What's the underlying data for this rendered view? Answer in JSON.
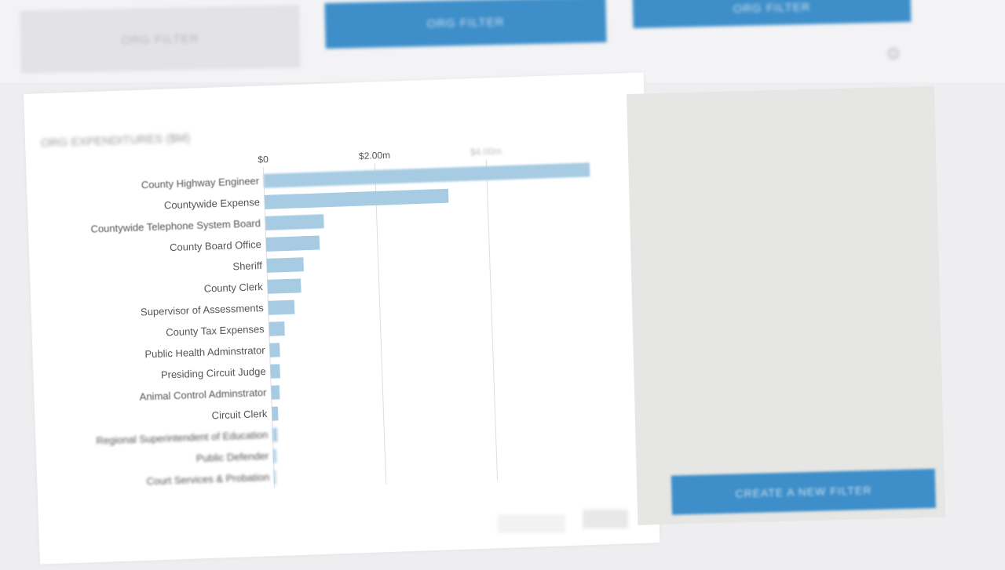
{
  "top_buttons": {
    "grey_label": "ORG FILTER",
    "blue_left_label": "ORG FILTER",
    "blue_right_label": "ORG FILTER"
  },
  "panel": {
    "title": "ORG EXPENDITURES ($M)"
  },
  "side_panel": {
    "text": "",
    "button_label": "CREATE A NEW FILTER"
  },
  "footer": {
    "left": "",
    "right_1": "",
    "right_2": ""
  },
  "colors": {
    "bar": "#a6cbe3",
    "accent": "#3d8ec9",
    "grid": "#dddddd",
    "label": "#555555"
  },
  "chart_data": {
    "type": "bar",
    "orientation": "horizontal",
    "categories": [
      "County Highway Engineer",
      "Countywide Expense",
      "Countywide Telephone System Board",
      "County Board Office",
      "Sheriff",
      "County Clerk",
      "Supervisor of Assessments",
      "County Tax Expenses",
      "Public Health Adminstrator",
      "Presiding Circuit Judge",
      "Animal Control Adminstrator",
      "Circuit Clerk",
      "Regional Superintendent of Education",
      "Public Defender",
      "Court Services & Probation"
    ],
    "values": [
      5.85,
      3.3,
      1.05,
      0.96,
      0.66,
      0.6,
      0.47,
      0.28,
      0.18,
      0.17,
      0.15,
      0.11,
      0.08,
      0.05,
      0.03
    ],
    "x_ticks": [
      "$0",
      "$2.00m",
      "$4.00m"
    ],
    "xlim": [
      0,
      6
    ],
    "grid": true
  }
}
